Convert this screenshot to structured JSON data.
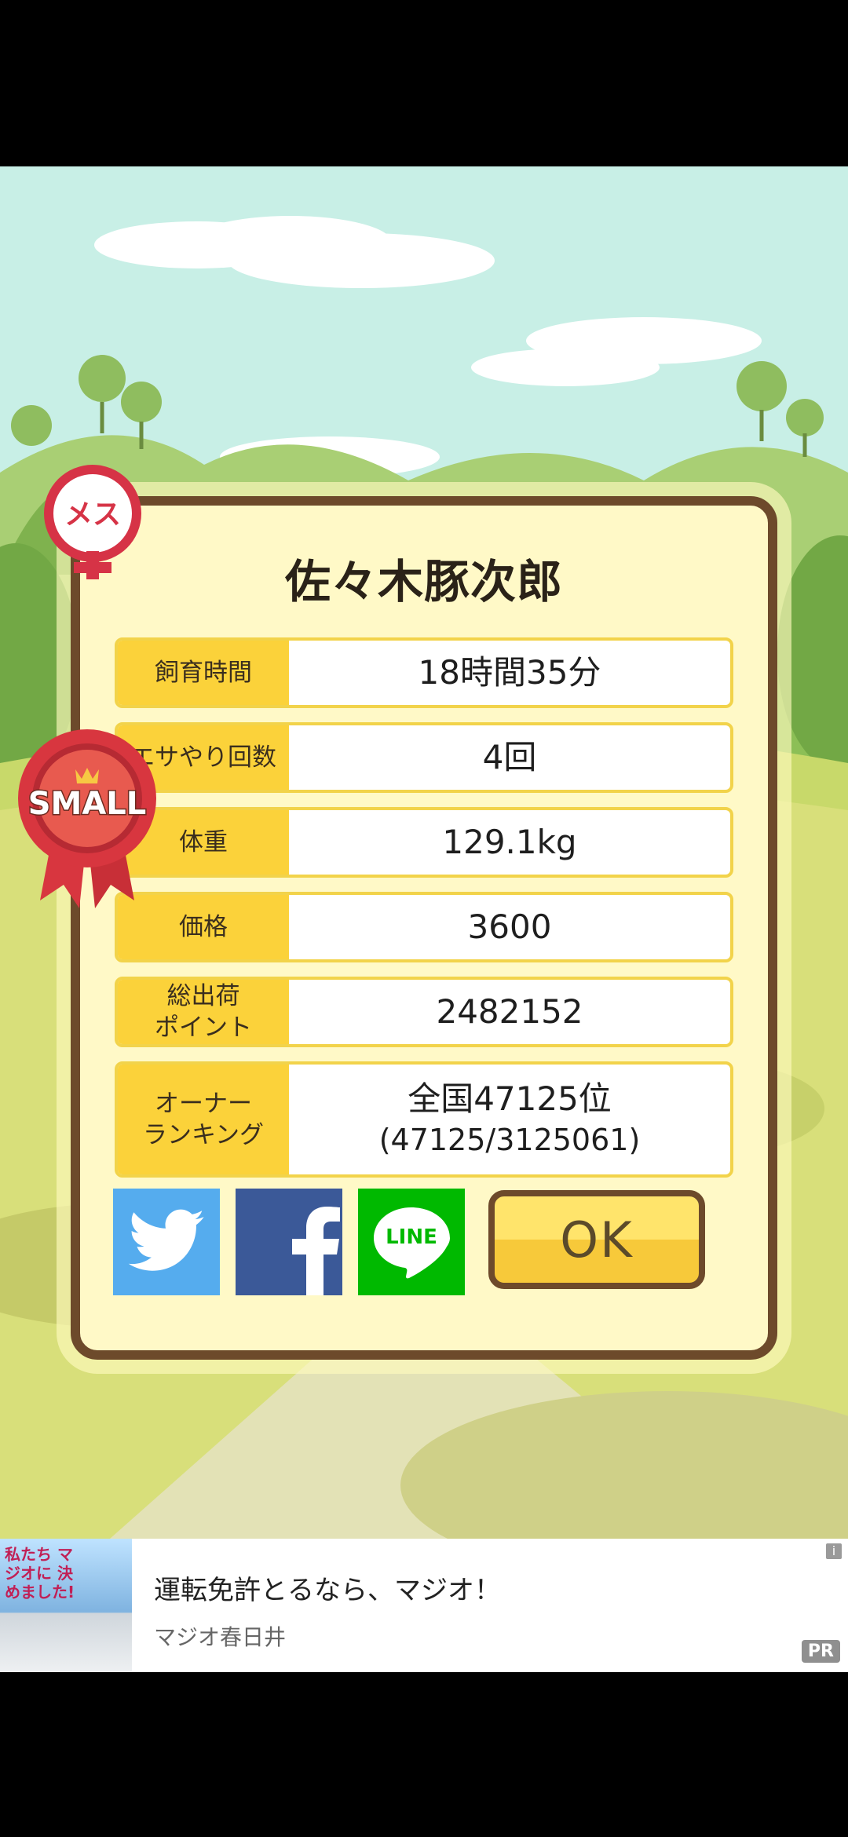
{
  "pig": {
    "name": "佐々木豚次郎",
    "sex_badge": "メス",
    "size_badge": "SMALL"
  },
  "stats": [
    {
      "label": "飼育時間",
      "value": "18時間35分"
    },
    {
      "label": "エサやり回数",
      "value": "4回"
    },
    {
      "label": "体重",
      "value": "129.1kg"
    },
    {
      "label": "価格",
      "value": "3600"
    },
    {
      "label": "総出荷\nポイント",
      "value": "2482152"
    },
    {
      "label": "オーナー\nランキング",
      "value": "全国47125位",
      "value_sub": "(47125/3125061)"
    }
  ],
  "share": {
    "twitter": "twitter-icon",
    "facebook": "facebook-icon",
    "line": "LINE"
  },
  "ok_label": "OK",
  "ad": {
    "thumb_text": "私たち マジオに 決めました!",
    "headline": "運転免許とるなら、マジオ！",
    "advertiser": "マジオ春日井",
    "pr": "PR",
    "info": "i"
  },
  "colors": {
    "panel_bg": "#fff9c7",
    "panel_border": "#6d4a2b",
    "label_bg": "#fbd23a",
    "twitter": "#55acee",
    "facebook": "#3b5998",
    "line": "#00b900"
  }
}
